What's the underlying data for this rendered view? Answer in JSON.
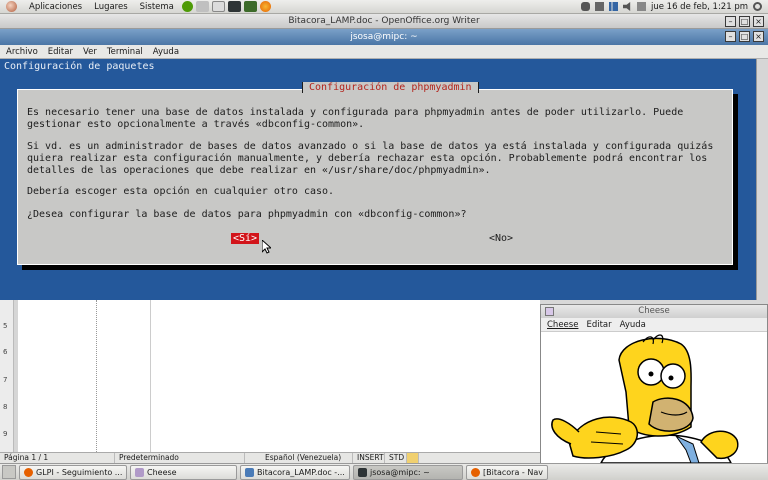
{
  "top_panel": {
    "menus": [
      "Aplicaciones",
      "Lugares",
      "Sistema"
    ],
    "clock": "jue 16 de feb,  1:21 pm",
    "icons": [
      "ubuntu-logo-icon",
      "firefox-icon",
      "terminal-icon",
      "bluetooth-icon",
      "network-icon",
      "volume-icon",
      "mail-icon",
      "power-icon"
    ]
  },
  "writer_window": {
    "title": "Bitacora_LAMP.doc - OpenOffice.org Writer",
    "status": [
      "Página  1 / 1",
      "Predeterminado",
      "Español (Venezuela)",
      "INSERT",
      "STD"
    ],
    "ruler_numbers": [
      "5",
      "5",
      "6",
      "7",
      "8",
      "9"
    ]
  },
  "terminal": {
    "title": "jsosa@mipc: ~",
    "menu": [
      "Archivo",
      "Editar",
      "Ver",
      "Terminal",
      "Ayuda"
    ],
    "screen_header": "Configuración de paquetes",
    "dialog": {
      "title": "Configuración de phpmyadmin",
      "paragraph1": "Es necesario tener una base de datos instalada y configurada para phpmyadmin antes de poder utilizarlo. Puede\ngestionar esto opcionalmente a través «dbconfig-common».",
      "paragraph2": "Si vd. es un administrador de bases de datos avanzado o si la base de datos ya está instalada y configurada quizás\nquiera realizar esta configuración manualmente, y debería rechazar esta opción. Probablemente podrá encontrar los\ndetalles de las operaciones que debe realizar en «/usr/share/doc/phpmyadmin».",
      "paragraph3": "Debería escoger esta opción en cualquier otro caso.",
      "question": "¿Desea configurar la base de datos para phpmyadmin con «dbconfig-common»?",
      "yes_label": "<Sí>",
      "no_label": "<No>"
    }
  },
  "cheese_window": {
    "title": "Cheese",
    "menu": [
      "Cheese",
      "Editar",
      "Ayuda"
    ]
  },
  "taskbar": {
    "items": [
      {
        "label": "GLPI - Seguimiento ...",
        "icon": "firefox-icon",
        "color": "#e66000"
      },
      {
        "label": "Cheese",
        "icon": "cheese-icon",
        "color": "#b09ac8"
      },
      {
        "label": "Bitacora_LAMP.doc -...",
        "icon": "writer-icon",
        "color": "#4a7bb7"
      },
      {
        "label": "jsosa@mipc: ~",
        "icon": "terminal-icon",
        "color": "#2e3436"
      },
      {
        "label": "[Bitacora - Nav",
        "icon": "browser-icon",
        "color": "#e66000"
      }
    ]
  }
}
